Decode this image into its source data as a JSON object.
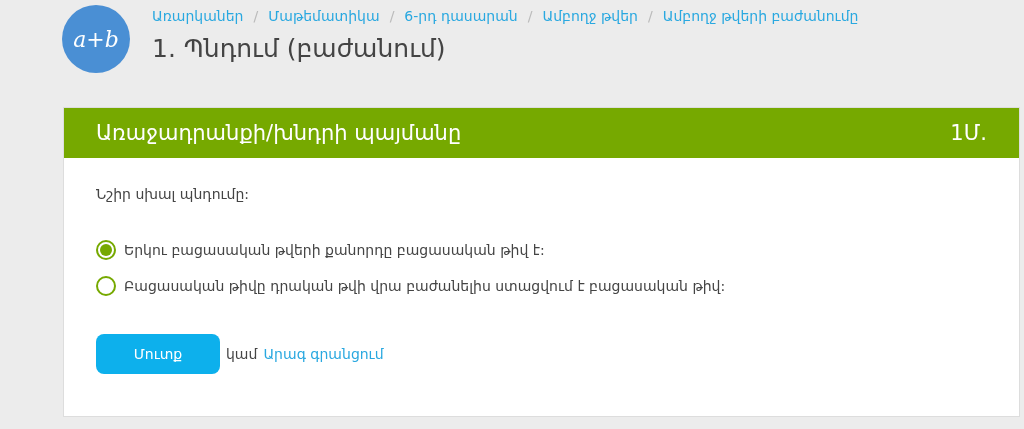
{
  "logo": {
    "text": "a+b"
  },
  "breadcrumbs": [
    {
      "kind": "link",
      "text": "Առարկաներ"
    },
    {
      "kind": "separator",
      "text": "/"
    },
    {
      "kind": "link",
      "text": "Մաթեմատիկա"
    },
    {
      "kind": "separator",
      "text": "/"
    },
    {
      "kind": "link",
      "text": "6-րդ դասարան"
    },
    {
      "kind": "separator",
      "text": "/"
    },
    {
      "kind": "link",
      "text": "Ամբողջ թվեր"
    },
    {
      "kind": "separator",
      "text": "/"
    },
    {
      "kind": "link",
      "text": "Ամբողջ թվերի բաժանումը"
    }
  ],
  "title": "1. Պնդում (բաժանում)",
  "card": {
    "header": "Առաջադրանքի/խնդրի պայմանը",
    "points": "1Մ.",
    "prompt": "Նշիր սխալ պնդումը:",
    "options": [
      {
        "label": "Երկու բացասական թվերի քանորդը բացասական թիվ է:",
        "selected": true
      },
      {
        "label": "Բացասական թիվը դրական թվի վրա բաժանելիս ստացվում է բացասական թիվ:",
        "selected": false
      }
    ],
    "button": "Մուտք",
    "or_text": "կամ",
    "link": "Արագ գրանցում"
  }
}
